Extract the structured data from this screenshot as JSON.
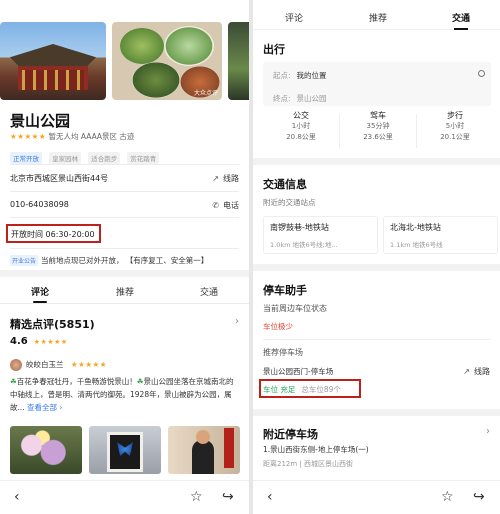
{
  "left": {
    "photo_watermark": "大众点评",
    "poi": {
      "name": "景山公园",
      "stars": "★★★★★",
      "rating_text": "暂无人均  AAAA景区 古迹",
      "tags": [
        "正常开放",
        "皇家园林",
        "适合跑步",
        "赏花踏青"
      ]
    },
    "address": "北京市西城区景山西街44号",
    "route_label": "线路",
    "phone": "010-64038098",
    "phone_label": "电话",
    "hours": "开放时间  06:30-20:00",
    "notice_badge": "开业公告",
    "notice_text": "当前地点现已对外开放，",
    "notice_extra": "【有序复工、安全第一】",
    "tabs": [
      "评论",
      "推荐",
      "交通"
    ],
    "reviews": {
      "title": "精选点评(5851)",
      "score": "4.6",
      "score_stars": "★★★★★",
      "reviewer": "皎皎白玉兰",
      "reviewer_stars": "★★★★★",
      "text_leaf1": "☘",
      "text_part1": "百花争春冠牡丹，千鱼畅游悦景山！",
      "text_leaf2": "☘",
      "text_part2": "景山公园坐落在京城南北的中轴线上，曾是明、清两代的御苑。1928年，景山被辟为公园，属故...",
      "more": "查看全部 ›"
    }
  },
  "right": {
    "tabs": [
      "评论",
      "推荐",
      "交通"
    ],
    "travel": {
      "title": "出行",
      "from_label": "起点:",
      "from_value": "我的位置",
      "to_label": "终点:",
      "to_value": "景山公园",
      "modes": [
        {
          "name": "公交",
          "time": "1小时",
          "dist": "20.8公里"
        },
        {
          "name": "驾车",
          "time": "35分钟",
          "dist": "23.6公里"
        },
        {
          "name": "步行",
          "time": "5小时",
          "dist": "20.1公里"
        }
      ]
    },
    "transit": {
      "title": "交通信息",
      "subtitle": "附近的交通站点",
      "stations": [
        {
          "name": "南锣鼓巷-地铁站",
          "dist": "1.0km",
          "lines": "地铁6号线;地..."
        },
        {
          "name": "北海北-地铁站",
          "dist": "1.1km",
          "lines": "地铁6号线"
        }
      ]
    },
    "parking": {
      "title": "停车助手",
      "status_label": "当前周边车位状态",
      "status_value": "车位极少",
      "recommend": "推荐停车场",
      "lot_name": "景山公园西门-停车场",
      "route_label": "线路",
      "vacancy": "车位 充足",
      "total": "总车位89个"
    },
    "nearby": {
      "title": "附近停车场",
      "item": "1.景山西街东侧-地上停车场(一)",
      "distance": "距离212m",
      "area": "西城区景山西街"
    }
  },
  "colors": {
    "accent_blue": "#3a7be8",
    "star_orange": "#f5a623",
    "highlight_red": "#c0201a",
    "status_red": "#e0402a",
    "status_green": "#1aa35a"
  }
}
